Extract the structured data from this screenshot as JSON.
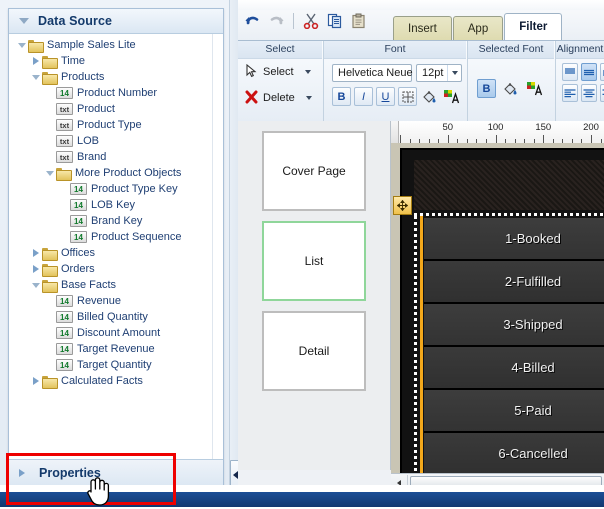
{
  "datasource": {
    "header_title": "Data Source",
    "properties_title": "Properties",
    "tree": [
      {
        "label": "Sample Sales Lite",
        "depth": 0,
        "icon": "folder",
        "state": "expanded"
      },
      {
        "label": "Time",
        "depth": 1,
        "icon": "folder",
        "state": "collapsed"
      },
      {
        "label": "Products",
        "depth": 1,
        "icon": "folder",
        "state": "expanded"
      },
      {
        "label": "Product Number",
        "depth": 2,
        "icon": "num",
        "state": "leaf"
      },
      {
        "label": "Product",
        "depth": 2,
        "icon": "txt",
        "state": "leaf"
      },
      {
        "label": "Product Type",
        "depth": 2,
        "icon": "txt",
        "state": "leaf"
      },
      {
        "label": "LOB",
        "depth": 2,
        "icon": "txt",
        "state": "leaf"
      },
      {
        "label": "Brand",
        "depth": 2,
        "icon": "txt",
        "state": "leaf"
      },
      {
        "label": "More Product Objects",
        "depth": 2,
        "icon": "folder",
        "state": "expanded"
      },
      {
        "label": "Product Type Key",
        "depth": 3,
        "icon": "num",
        "state": "leaf"
      },
      {
        "label": "LOB Key",
        "depth": 3,
        "icon": "num",
        "state": "leaf"
      },
      {
        "label": "Brand Key",
        "depth": 3,
        "icon": "num",
        "state": "leaf"
      },
      {
        "label": "Product Sequence",
        "depth": 3,
        "icon": "num",
        "state": "leaf"
      },
      {
        "label": "Offices",
        "depth": 1,
        "icon": "folder",
        "state": "collapsed"
      },
      {
        "label": "Orders",
        "depth": 1,
        "icon": "folder",
        "state": "collapsed"
      },
      {
        "label": "Base Facts",
        "depth": 1,
        "icon": "folder",
        "state": "expanded"
      },
      {
        "label": "Revenue",
        "depth": 2,
        "icon": "num",
        "state": "leaf"
      },
      {
        "label": "Billed Quantity",
        "depth": 2,
        "icon": "num",
        "state": "leaf"
      },
      {
        "label": "Discount Amount",
        "depth": 2,
        "icon": "num",
        "state": "leaf"
      },
      {
        "label": "Target Revenue",
        "depth": 2,
        "icon": "num",
        "state": "leaf"
      },
      {
        "label": "Target Quantity",
        "depth": 2,
        "icon": "num",
        "state": "leaf"
      },
      {
        "label": "Calculated Facts",
        "depth": 1,
        "icon": "folder",
        "state": "collapsed"
      }
    ],
    "badge_num_text": "14",
    "badge_txt_text": "txt"
  },
  "quick_toolbar": {
    "buttons": [
      {
        "name": "undo-icon",
        "title": "Undo",
        "enabled": true
      },
      {
        "name": "redo-icon",
        "title": "Redo",
        "enabled": false
      },
      {
        "name": "cut-icon",
        "title": "Cut",
        "enabled": true
      },
      {
        "name": "copy-icon",
        "title": "Copy",
        "enabled": true
      },
      {
        "name": "paste-icon",
        "title": "Paste",
        "enabled": true
      }
    ]
  },
  "tabs": [
    {
      "label": "Insert",
      "active": false
    },
    {
      "label": "App",
      "active": false
    },
    {
      "label": "Filter",
      "active": true
    }
  ],
  "ribbon": {
    "groups": [
      {
        "name": "select",
        "label": "Select"
      },
      {
        "name": "font",
        "label": "Font"
      },
      {
        "name": "selected-font",
        "label": "Selected Font"
      },
      {
        "name": "alignment",
        "label": "Alignment"
      }
    ],
    "select_group": {
      "select_label": "Select",
      "delete_label": "Delete"
    },
    "font_group": {
      "font_family_value": "Helvetica Neue",
      "font_size_value": "12pt",
      "bold_label": "B",
      "italic_label": "I",
      "underline_label": "U"
    },
    "selected_font_group": {
      "bold_label": "B"
    }
  },
  "pages": [
    {
      "label": "Cover Page",
      "selected": false
    },
    {
      "label": "List",
      "selected": true
    },
    {
      "label": "Detail",
      "selected": false
    }
  ],
  "canvas": {
    "ruler_marks": [
      "50",
      "100",
      "150",
      "200"
    ],
    "rows": [
      "1-Booked",
      "2-Fulfilled",
      "3-Shipped",
      "4-Billed",
      "5-Paid",
      "6-Cancelled"
    ],
    "selection_accent": "#f3a81b"
  },
  "annotation": {
    "highlight_color": "#ee0000"
  }
}
